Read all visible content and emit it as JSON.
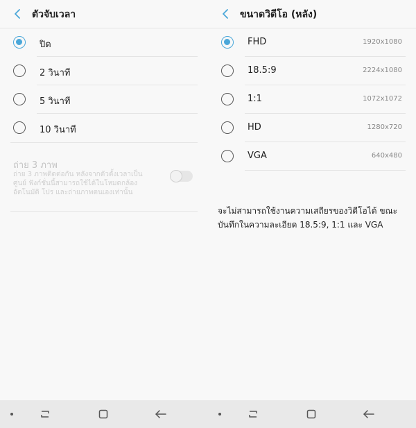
{
  "left": {
    "title": "ตัวจับเวลา",
    "options": [
      {
        "label": "ปิด",
        "selected": true
      },
      {
        "label": "2 วินาที",
        "selected": false
      },
      {
        "label": "5 วินาที",
        "selected": false
      },
      {
        "label": "10 วินาที",
        "selected": false
      }
    ],
    "burst": {
      "title": "ถ่าย 3 ภาพ",
      "description": "ถ่าย 3 ภาพติดต่อกัน หลังจากตัวตั้งเวลาเป็นศูนย์ ฟังก์ชั่นนี้สามารถใช้ได้ในโหมดกล้องอัตโนมัติ โปร และถ่ายภาพตนเองเท่านั้น",
      "enabled": false
    }
  },
  "right": {
    "title": "ขนาดวิดีโอ (หลัง)",
    "options": [
      {
        "label": "FHD",
        "resolution": "1920x1080",
        "selected": true
      },
      {
        "label": "18.5:9",
        "resolution": "2224x1080",
        "selected": false
      },
      {
        "label": "1:1",
        "resolution": "1072x1072",
        "selected": false
      },
      {
        "label": "HD",
        "resolution": "1280x720",
        "selected": false
      },
      {
        "label": "VGA",
        "resolution": "640x480",
        "selected": false
      }
    ],
    "note": "จะไม่สามารถใช้งานความเสถียรของวิดีโอได้ ขณะบันทึกในความละเอียด 18.5:9, 1:1 และ VGA"
  },
  "colors": {
    "accent": "#4aa7d9",
    "background": "#f8f8f8",
    "navbar": "#e9e9e9",
    "disabled_text": "#c4c4c4"
  },
  "navbar": {
    "icons": [
      "dot-icon",
      "recents-icon",
      "home-icon",
      "back-icon"
    ]
  }
}
